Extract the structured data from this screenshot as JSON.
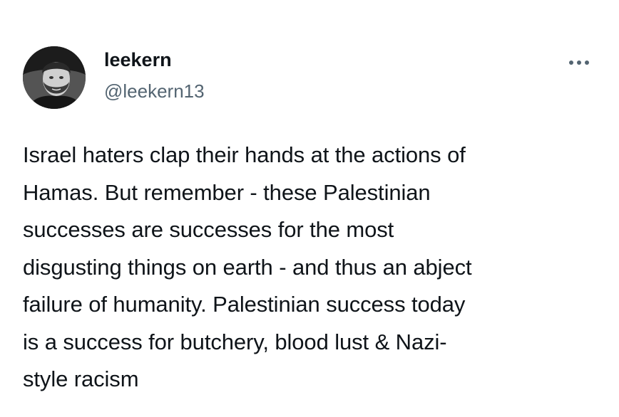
{
  "author": {
    "display_name": "leekern",
    "handle": "@leekern13",
    "avatar_icon": "profile-photo"
  },
  "header": {
    "more_icon": "more-horizontal-icon"
  },
  "tweet": {
    "text": "Israel haters clap their hands at the actions of\nHamas. But remember - these Palestinian\nsuccesses are successes for the most\ndisgusting things on earth - and thus an abject\nfailure of humanity. Palestinian success today\nis a success for butchery, blood lust & Nazi-\nstyle racism"
  },
  "colors": {
    "text_primary": "#0f1419",
    "text_secondary": "#536471",
    "background": "#ffffff"
  }
}
